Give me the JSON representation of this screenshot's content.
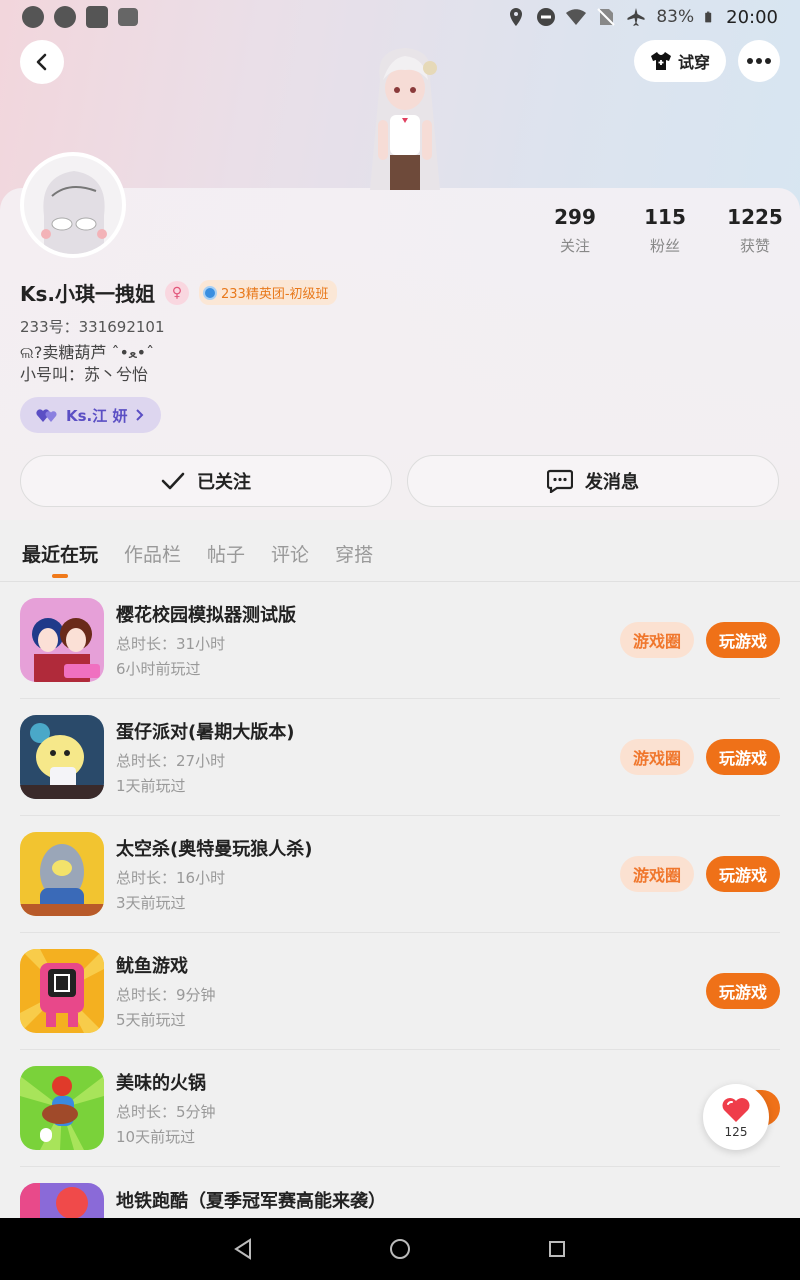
{
  "status_bar": {
    "battery": "83%",
    "time": "20:00"
  },
  "header": {
    "tryon_label": "试穿"
  },
  "profile": {
    "stats": [
      {
        "value": "299",
        "label": "关注"
      },
      {
        "value": "115",
        "label": "粉丝"
      },
      {
        "value": "1225",
        "label": "获赞"
      }
    ],
    "name": "Ks.小琪一拽姐",
    "badge": "233精英团-初级班",
    "uid": "233号：331692101",
    "bio": "ଲ?卖糖葫芦 ˆ•ﻌ•ˆ\n小号叫：苏丶兮怡",
    "relation_chip": "Ks.江 妍",
    "follow_label": "已关注",
    "message_label": "发消息"
  },
  "tabs": [
    "最近在玩",
    "作品栏",
    "帖子",
    "评论",
    "穿搭"
  ],
  "games": [
    {
      "title": "樱花校园模拟器测试版",
      "duration": "总时长：31小时",
      "last_played": "6小时前玩过",
      "circle": "游戏圈",
      "play": "玩游戏",
      "icon": "sakura-school-icon"
    },
    {
      "title": "蛋仔派对(暑期大版本)",
      "duration": "总时长：27小时",
      "last_played": "1天前玩过",
      "circle": "游戏圈",
      "play": "玩游戏",
      "icon": "eggy-party-icon"
    },
    {
      "title": "太空杀(奥特曼玩狼人杀)",
      "duration": "总时长：16小时",
      "last_played": "3天前玩过",
      "circle": "游戏圈",
      "play": "玩游戏",
      "icon": "space-kill-icon"
    },
    {
      "title": "鱿鱼游戏",
      "duration": "总时长：9分钟",
      "last_played": "5天前玩过",
      "circle": "",
      "play": "玩游戏",
      "icon": "squid-game-icon"
    },
    {
      "title": "美味的火锅",
      "duration": "总时长：5分钟",
      "last_played": "10天前玩过",
      "circle": "",
      "play": "",
      "icon": "hotpot-icon"
    },
    {
      "title": "地铁跑酷（夏季冠军赛高能来袭）",
      "duration": "",
      "last_played": "",
      "circle": "",
      "play": "",
      "icon": "subway-surfers-icon"
    }
  ],
  "like_float": {
    "count": "125"
  },
  "colors": {
    "accent": "#ef7118",
    "accent_light": "#fbe1d1",
    "chip": "#ddd6ef"
  }
}
